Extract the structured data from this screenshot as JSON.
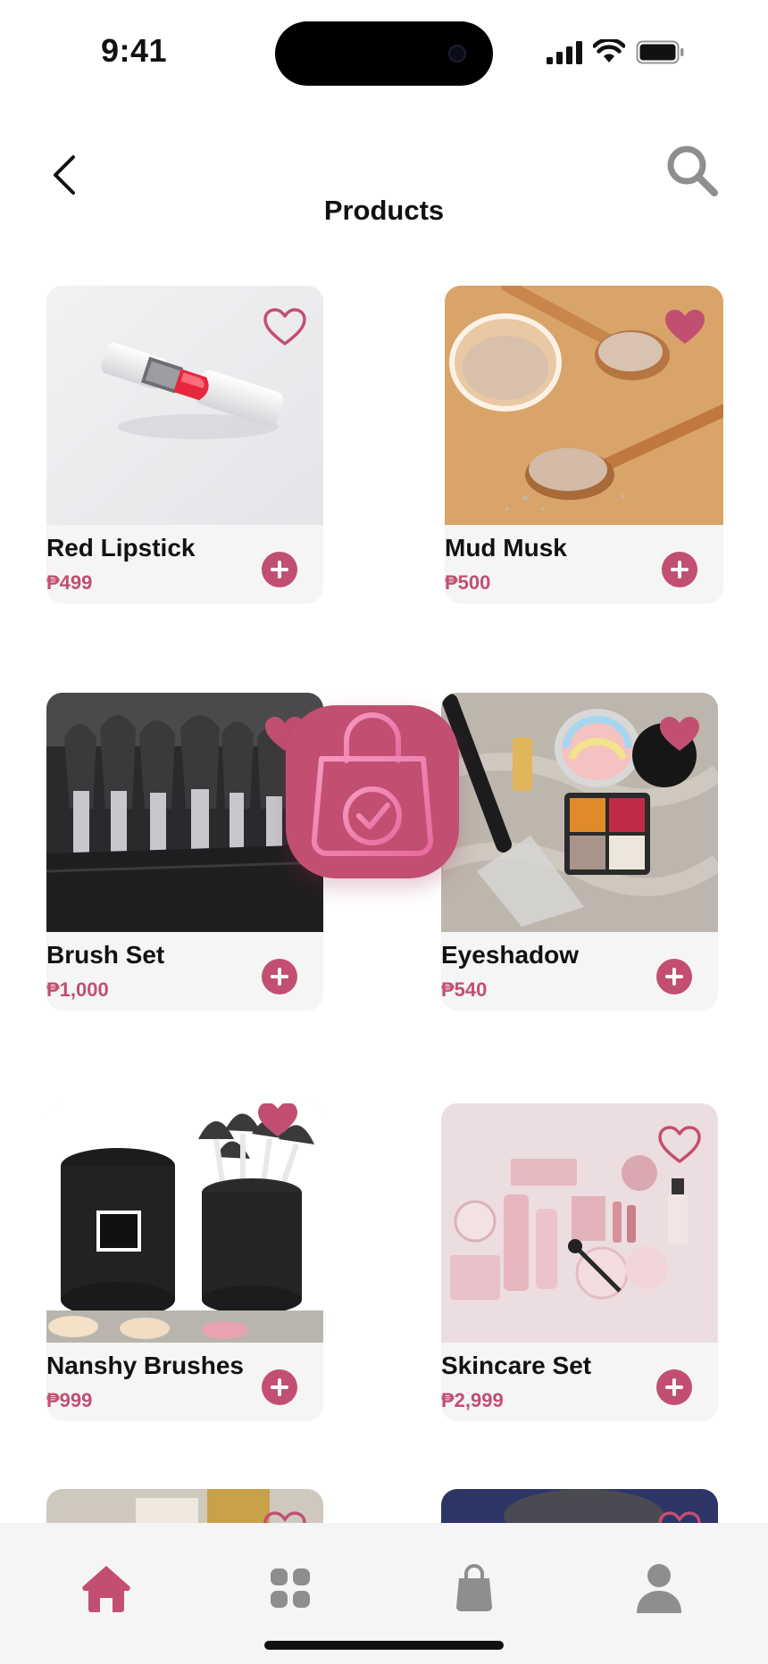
{
  "status_bar": {
    "time": "9:41"
  },
  "header": {
    "title": "Products",
    "back_icon": "chevron-left-icon",
    "search_icon": "search-icon"
  },
  "colors": {
    "accent": "#c24f72",
    "card_bg": "#f5f5f5",
    "nav_bg": "#f5f5f5",
    "inactive_icon": "#8e8e8e"
  },
  "products": [
    {
      "name": "Red Lipstick",
      "price": "₱499",
      "favorited": false
    },
    {
      "name": "Mud Musk",
      "price": "₱500",
      "favorited": true
    },
    {
      "name": "Brush Set",
      "price": "₱1,000",
      "favorited": true
    },
    {
      "name": "Eyeshadow",
      "price": "₱540",
      "favorited": true
    },
    {
      "name": "Nanshy Brushes",
      "price": "₱999",
      "favorited": true
    },
    {
      "name": "Skincare Set",
      "price": "₱2,999",
      "favorited": false
    }
  ],
  "overlay": {
    "icon": "shopping-bag-check-icon"
  },
  "bottom_nav": {
    "items": [
      {
        "icon": "home-icon",
        "active": true
      },
      {
        "icon": "grid-icon",
        "active": false
      },
      {
        "icon": "shopping-bag-icon",
        "active": false
      },
      {
        "icon": "profile-icon",
        "active": false
      }
    ]
  }
}
